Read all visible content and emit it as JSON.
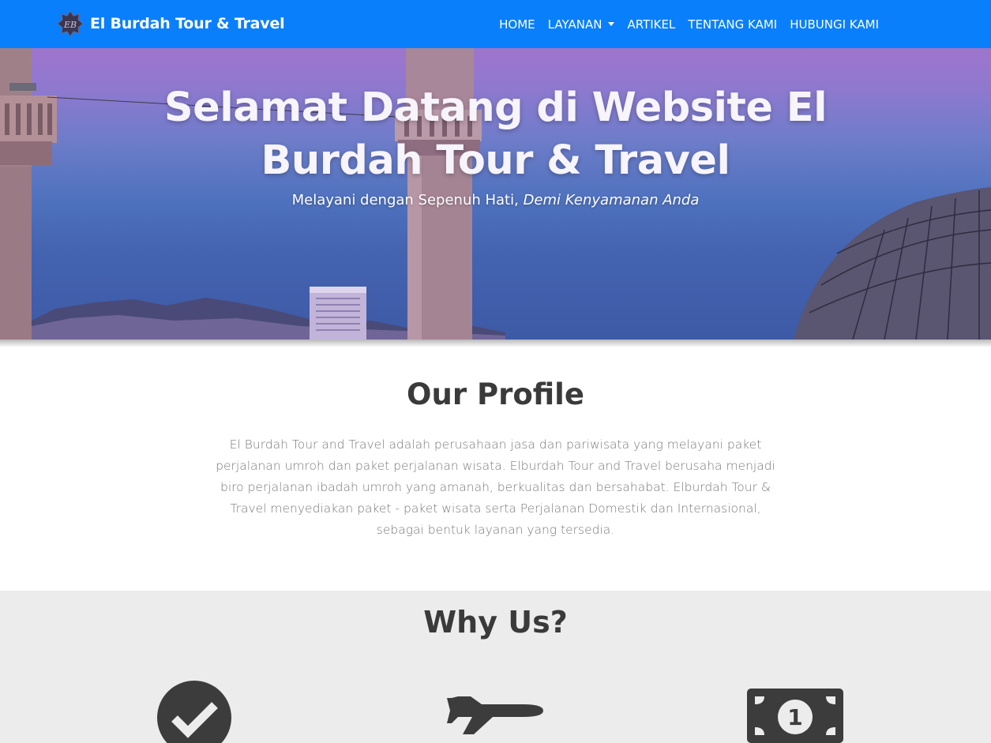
{
  "navbar": {
    "brand": "El Burdah Tour & Travel",
    "brand_logo_icon": "eb-star-logo-icon",
    "background_color": "#0a7ffb",
    "links": [
      {
        "label": "HOME"
      },
      {
        "label": "LAYANAN",
        "dropdown": true
      },
      {
        "label": "ARTIKEL"
      },
      {
        "label": "TENTANG KAMI"
      },
      {
        "label": "HUBUNGI KAMI"
      }
    ]
  },
  "hero": {
    "title": "Selamat Datang di Website El Burdah Tour & Travel",
    "subtitle_plain": "Melayani dengan Sepenuh Hati, ",
    "subtitle_italic": "Demi Kenyamanan Anda"
  },
  "profile": {
    "title": "Our Profile",
    "text": "El Burdah Tour and Travel adalah perusahaan jasa dan pariwisata yang melayani paket perjalanan umroh dan paket perjalanan wisata. Elburdah Tour and Travel berusaha menjadi biro perjalanan ibadah umroh yang amanah, berkualitas dan bersahabat. Elburdah Tour & Travel menyediakan paket - paket wisata serta Perjalanan Domestik dan Internasional, sebagai bentuk layanan yang tersedia."
  },
  "why_us": {
    "title": "Why Us?",
    "icons": [
      "check-circle-icon",
      "plane-icon",
      "money-bill-icon"
    ],
    "money_digit": "1",
    "icon_color": "#3c3c3c",
    "background_color": "#ececec"
  }
}
